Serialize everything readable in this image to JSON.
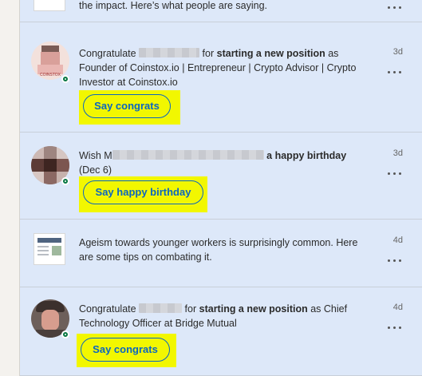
{
  "feed": {
    "item0": {
      "text_tail": "the impact. Here’s what people are saying."
    },
    "item1": {
      "prefix": "Congratulate",
      "mid": "for",
      "bold": "starting a new position",
      "suffix": "as Founder of Coinstox.io | Entrepreneur | Crypto Advisor | Crypto Investor at Coinstox.io",
      "time": "3d",
      "button": "Say congrats",
      "avatar_badge": "COINSTOX"
    },
    "item2": {
      "prefix": "Wish",
      "visible_initial": "M",
      "bold": "a happy birthday",
      "suffix": "(Dec 6)",
      "time": "3d",
      "button": "Say happy birthday"
    },
    "item3": {
      "text": "Ageism towards younger workers is surprisingly common. Here are some tips on combating it.",
      "time": "4d"
    },
    "item4": {
      "prefix": "Congratulate",
      "mid": "for",
      "bold": "starting a new position",
      "suffix": "as Chief Technology Officer at Bridge Mutual",
      "time": "4d",
      "button": "Say congrats"
    }
  },
  "colors": {
    "unread_bg": "#dde8f9",
    "highlight": "#f2f700",
    "button_blue": "#0a66c2",
    "online_green": "#057642"
  },
  "icons": [
    "more-options-icon",
    "online-status-icon",
    "article-thumbnail-icon"
  ]
}
